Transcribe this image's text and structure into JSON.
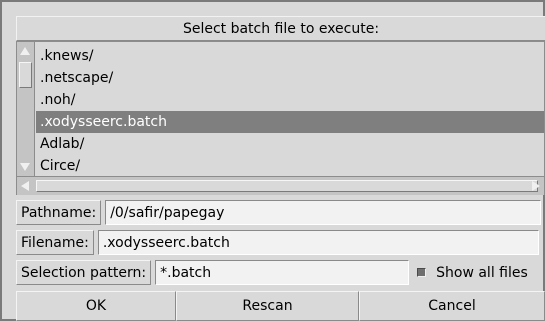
{
  "title": "Select batch file to execute:",
  "files": [
    {
      "name": ".knews/",
      "selected": false
    },
    {
      "name": ".netscape/",
      "selected": false
    },
    {
      "name": ".noh/",
      "selected": false
    },
    {
      "name": ".xodysseerc.batch",
      "selected": true
    },
    {
      "name": "Adlab/",
      "selected": false
    },
    {
      "name": "Circe/",
      "selected": false
    }
  ],
  "pathname": {
    "label": "Pathname:",
    "value": "/0/safir/papegay"
  },
  "filename": {
    "label": "Filename:",
    "value": ".xodysseerc.batch"
  },
  "pattern": {
    "label": "Selection pattern:",
    "value": "*.batch"
  },
  "show_all": {
    "label": "Show all files",
    "checked": true
  },
  "buttons": {
    "ok": "OK",
    "rescan": "Rescan",
    "cancel": "Cancel"
  },
  "colors": {
    "background": "#d9d9d9",
    "selection": "#7f7f7f",
    "field": "#f2f2f2"
  },
  "icons": {
    "scroll_up": "triangle-up-icon",
    "scroll_down": "triangle-down-icon",
    "scroll_left": "triangle-left-icon",
    "scroll_right": "triangle-right-icon"
  }
}
